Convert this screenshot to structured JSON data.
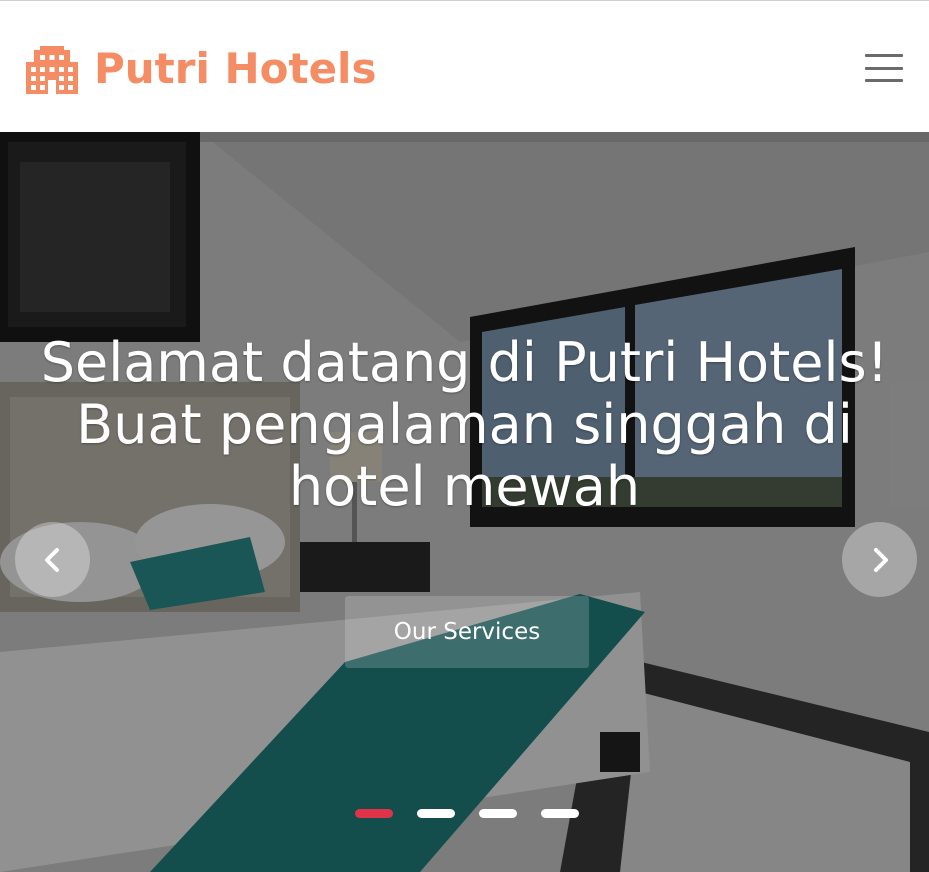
{
  "brand": {
    "name": "Putri Hotels",
    "icon": "building-icon",
    "color": "#f58c64"
  },
  "nav": {
    "menu_icon": "hamburger-menu-icon"
  },
  "hero": {
    "title_lines": [
      "Selamat datang di Putri Hotels!",
      "Buat pengalaman singgah di",
      "hotel mewah"
    ],
    "cta_label": "Our Services",
    "prev_icon": "chevron-left-icon",
    "next_icon": "chevron-right-icon",
    "slide_count": 4,
    "active_slide": 1,
    "active_indicator_color": "#e0334a"
  }
}
